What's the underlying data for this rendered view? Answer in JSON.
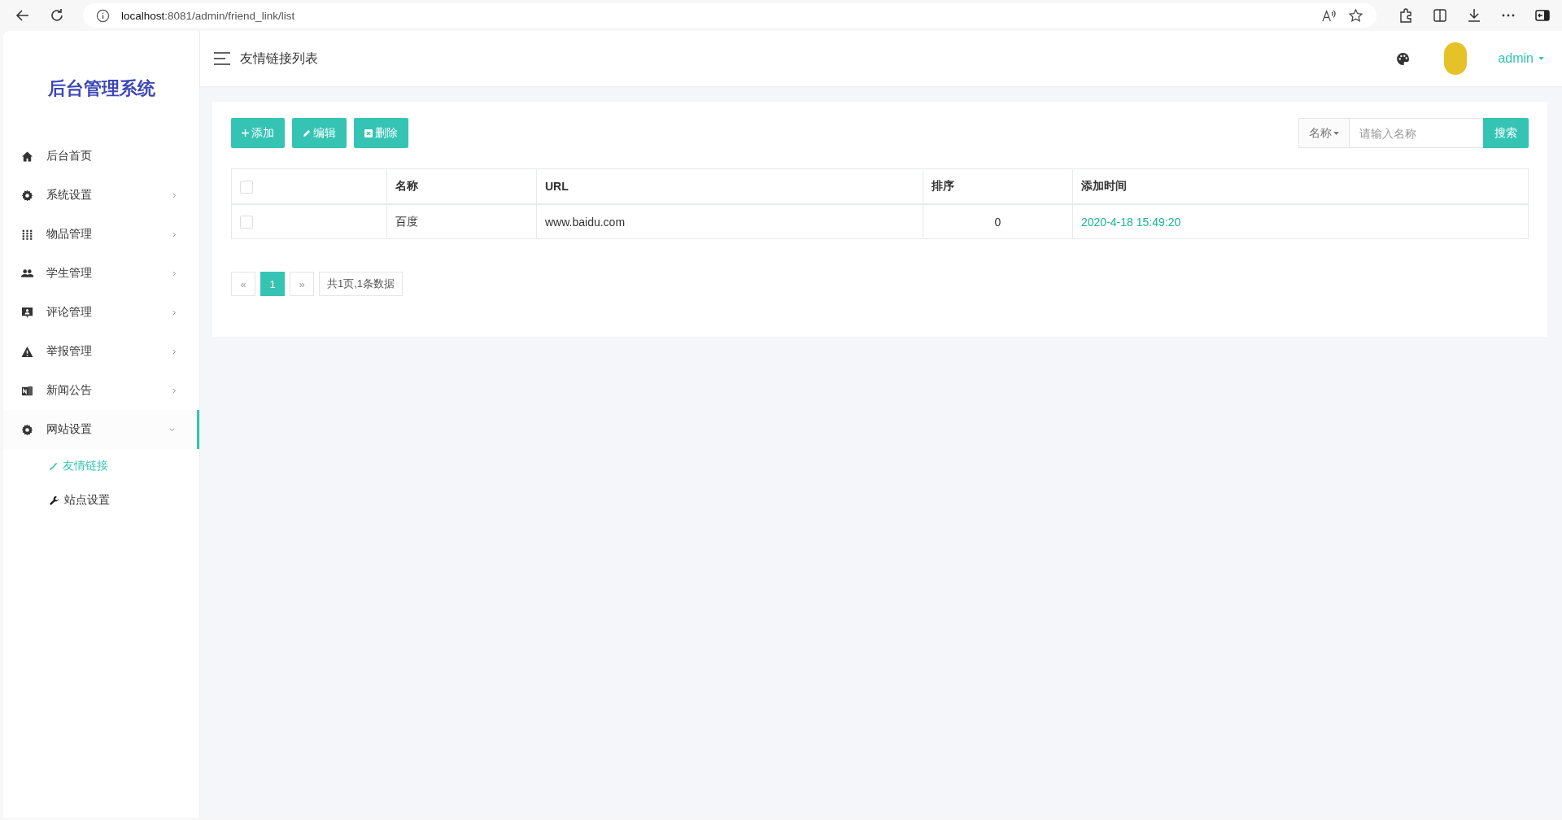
{
  "browser": {
    "url_host": "localhost",
    "url_path": ":8081/admin/friend_link/list"
  },
  "sidebar": {
    "logo": "后台管理系统",
    "items": [
      {
        "label": "后台首页",
        "kind": "link",
        "selected": false
      },
      {
        "label": "系统设置",
        "kind": "group",
        "expanded": false,
        "selected": false
      },
      {
        "label": "物品管理",
        "kind": "group",
        "expanded": false,
        "selected": false
      },
      {
        "label": "学生管理",
        "kind": "group",
        "expanded": false,
        "selected": false
      },
      {
        "label": "评论管理",
        "kind": "group",
        "expanded": false,
        "selected": false
      },
      {
        "label": "举报管理",
        "kind": "group",
        "expanded": false,
        "selected": false
      },
      {
        "label": "新闻公告",
        "kind": "group",
        "expanded": false,
        "selected": false
      },
      {
        "label": "网站设置",
        "kind": "group",
        "expanded": true,
        "selected": true,
        "children": [
          {
            "label": "友情链接",
            "selected": true
          },
          {
            "label": "站点设置",
            "selected": false
          }
        ]
      }
    ]
  },
  "header": {
    "title": "友情链接列表",
    "user": "admin"
  },
  "toolbar": {
    "buttons": [
      {
        "label": "添加"
      },
      {
        "label": "编辑"
      },
      {
        "label": "删除"
      }
    ]
  },
  "search": {
    "field": "名称",
    "placeholder": "请输入名称",
    "button": "搜索"
  },
  "table": {
    "columns": [
      "名称",
      "URL",
      "排序",
      "添加时间"
    ],
    "header_checked": false,
    "rows": [
      {
        "checked": false,
        "cells": [
          "百度",
          "www.baidu.com",
          "0",
          "2020-4-18 15:49:20"
        ]
      }
    ]
  },
  "pagination": {
    "prev": "«",
    "pages": [
      {
        "label": "1",
        "selected": true
      }
    ],
    "next": "»",
    "summary": "共1页,1条数据"
  }
}
